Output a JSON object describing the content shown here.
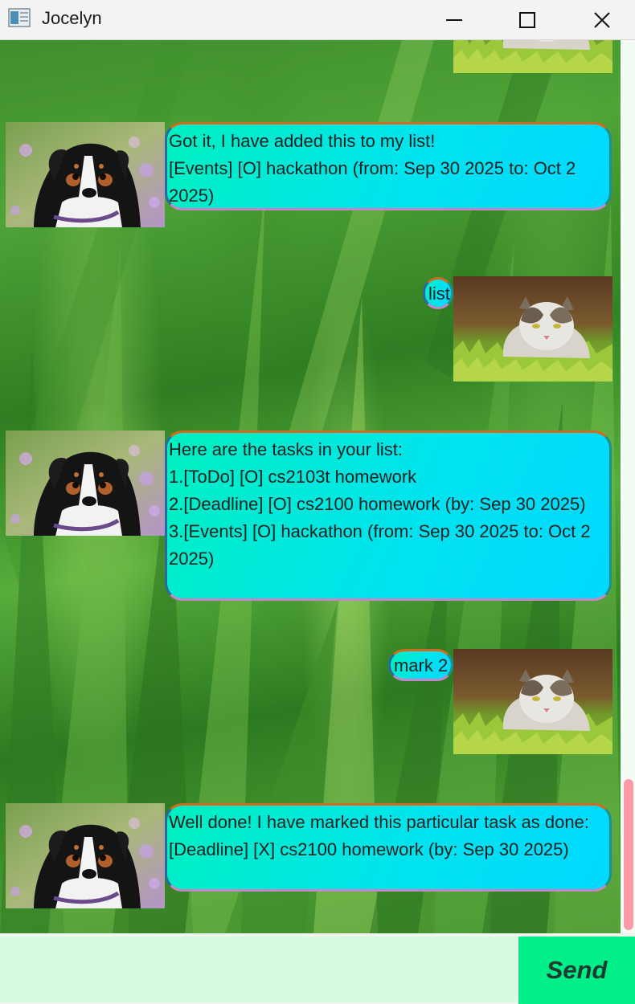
{
  "window": {
    "title": "Jocelyn"
  },
  "messages": [
    {
      "role": "user",
      "text": ""
    },
    {
      "role": "bot",
      "text": "Got it, I have added this to my list!\n[Events] [O] hackathon  (from: Sep 30 2025 to: Oct 2 2025)"
    },
    {
      "role": "user",
      "text": "list"
    },
    {
      "role": "bot",
      "text": "Here are the tasks in your list:\n1.[ToDo]  [O] cs2103t homework\n2.[Deadline] [O] cs2100 homework  (by: Sep 30 2025)\n3.[Events] [O] hackathon  (from: Sep 30 2025 to: Oct 2 2025)"
    },
    {
      "role": "user",
      "text": "mark 2"
    },
    {
      "role": "bot",
      "text": "Well done! I have marked this particular task as done:\n[Deadline] [X] cs2100 homework  (by: Sep 30 2025)"
    }
  ],
  "input": {
    "value": "",
    "placeholder": ""
  },
  "send_button": {
    "label": "Send"
  },
  "icons": {
    "app": "app-window-icon",
    "minimize": "minimize-icon",
    "maximize": "maximize-icon",
    "close": "close-icon",
    "bot_avatar": "dog-avatar",
    "user_avatar": "cat-avatar"
  },
  "colors": {
    "bubble_start": "#00f0c0",
    "bubble_end": "#00d8ff",
    "send_button": "#00ee88",
    "input_bg": "#d6fadf",
    "scroll_thumb": "#ff9aa8"
  }
}
